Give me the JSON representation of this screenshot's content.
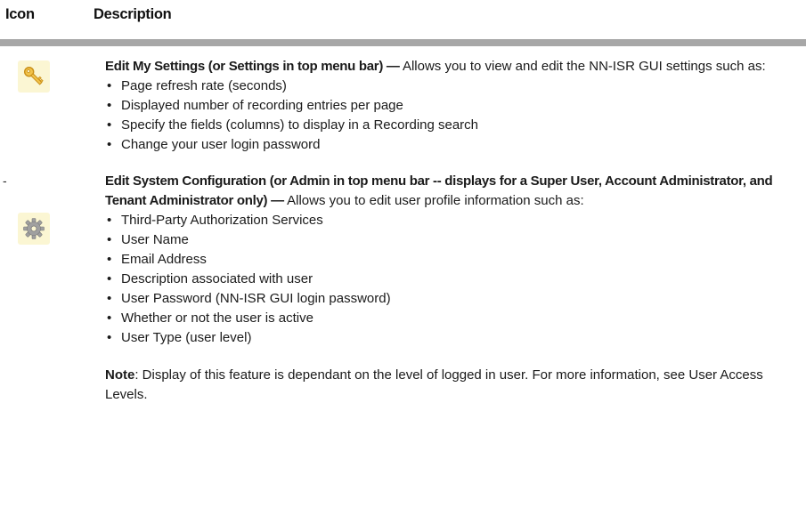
{
  "table": {
    "header": {
      "icon_col": "Icon",
      "description_col": "Description"
    },
    "rows": [
      {
        "icon": "key-icon",
        "leading_mark": "",
        "title": "Edit My Settings (or Settings in top menu bar) —",
        "text": " Allows you to view and edit the NN-ISR GUI settings such as:",
        "bullets": [
          "Page refresh rate (seconds)",
          "Displayed number of recording entries per page",
          "Specify the fields (columns) to display in a Recording search",
          "Change your user login password"
        ]
      },
      {
        "icon": "gear-icon",
        "leading_mark": "-",
        "title": "Edit System Configuration (or Admin in top menu bar -- displays for a Super User, Account Administrator, and Tenant Administrator only) —",
        "text": " Allows you to edit user profile information such as:",
        "bullets": [
          "Third-Party Authorization Services",
          "User Name",
          "Email Address",
          "Description associated with user",
          "User Password (NN-ISR GUI login password)",
          "Whether or not the user is active",
          "User Type (user level)"
        ],
        "note_label": "Note",
        "note_text": ": Display of this feature is dependant on the level of logged in user. For more information, see User Access Levels."
      }
    ]
  },
  "colors": {
    "header_rule": "#a7a7a7",
    "icon_background": "#fbf6d3",
    "key_icon": "#e3b23c",
    "gear_icon": "#9a9a9a"
  }
}
